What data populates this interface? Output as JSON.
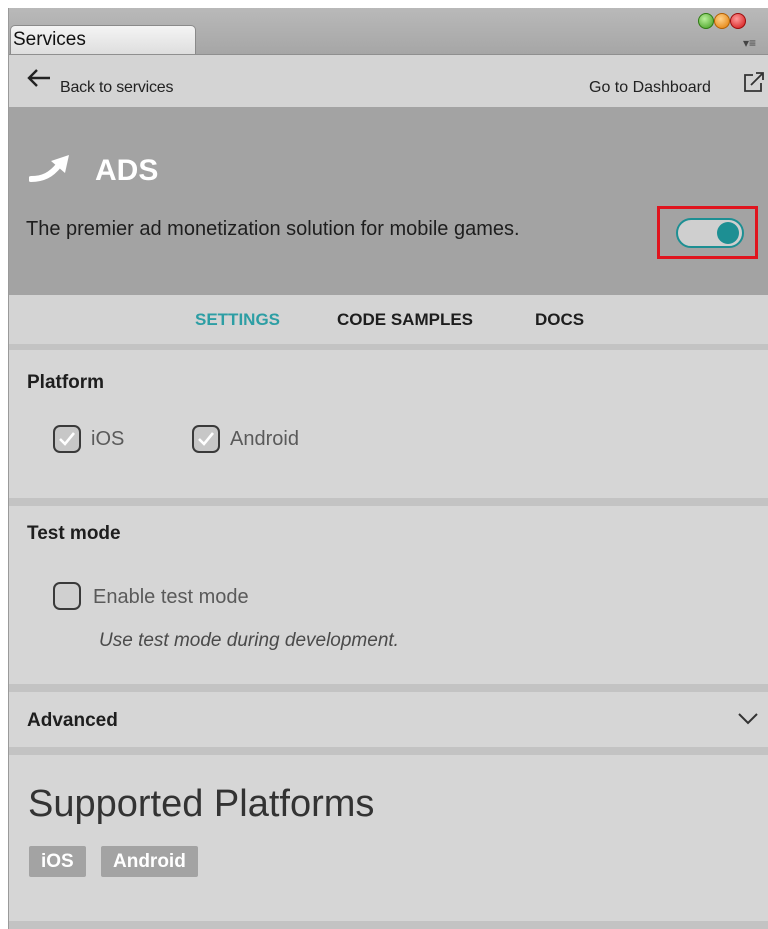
{
  "window": {
    "tab_title": "Services"
  },
  "nav": {
    "back_label": "Back to services",
    "dashboard_label": "Go to Dashboard"
  },
  "header": {
    "title": "ADS",
    "description": "The premier ad monetization solution for mobile games.",
    "enabled": true,
    "accent_color": "#1d8f93"
  },
  "tabs": [
    {
      "label": "SETTINGS",
      "active": true
    },
    {
      "label": "CODE SAMPLES",
      "active": false
    },
    {
      "label": "DOCS",
      "active": false
    }
  ],
  "platform": {
    "title": "Platform",
    "options": [
      {
        "label": "iOS",
        "checked": true
      },
      {
        "label": "Android",
        "checked": true
      }
    ]
  },
  "test_mode": {
    "title": "Test mode",
    "checkbox_label": "Enable test mode",
    "checked": false,
    "hint": "Use test mode during development."
  },
  "advanced": {
    "title": "Advanced",
    "icon": "chevron-down-icon"
  },
  "supported": {
    "title": "Supported Platforms",
    "badges": [
      "iOS",
      "Android"
    ]
  }
}
